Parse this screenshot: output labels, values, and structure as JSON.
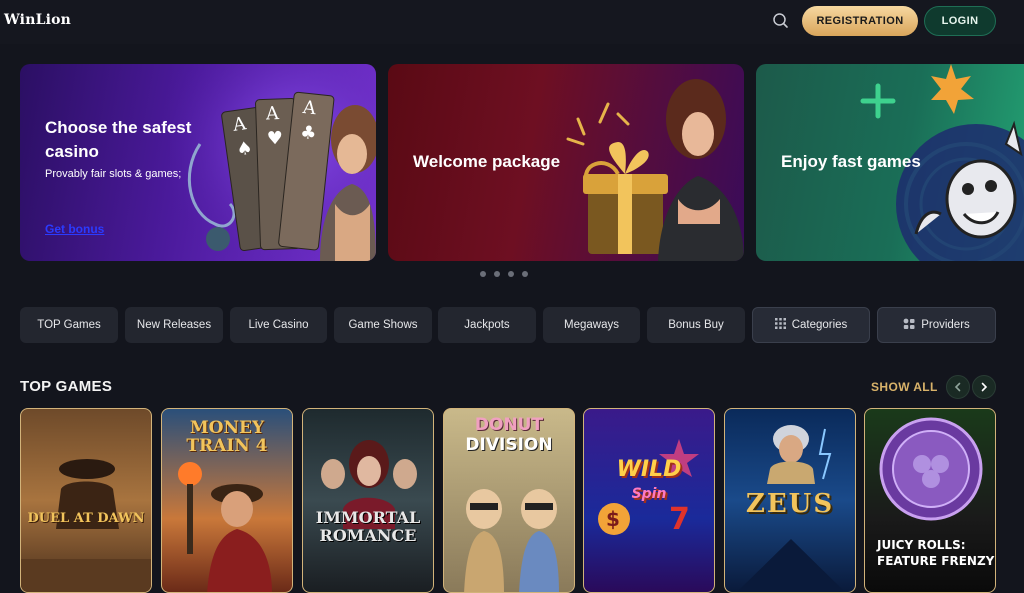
{
  "header": {
    "logo": "WinLion",
    "registration_label": "REGISTRATION",
    "login_label": "LOGIN",
    "search_icon": "search-icon"
  },
  "banners": [
    {
      "title_line1": "Choose the safest",
      "title_line2": "casino",
      "subtitle": "Provably fair slots & games;",
      "link": "Get bonus"
    },
    {
      "title": "Welcome package"
    },
    {
      "title": "Enjoy fast games"
    }
  ],
  "carousel": {
    "dot_count": 4
  },
  "categories": [
    {
      "label": "TOP Games"
    },
    {
      "label": "New Releases"
    },
    {
      "label": "Live Casino"
    },
    {
      "label": "Game Shows"
    },
    {
      "label": "Jackpots"
    },
    {
      "label": "Megaways"
    },
    {
      "label": "Bonus Buy"
    },
    {
      "label": "Categories",
      "icon": "grid-icon"
    },
    {
      "label": "Providers",
      "icon": "providers-icon"
    }
  ],
  "top_games": {
    "title": "TOP GAMES",
    "show_all": "SHOW ALL",
    "games": [
      {
        "title": "DUEL AT DAWN"
      },
      {
        "title_line1": "MONEY",
        "title_line2": "TRAIN 4"
      },
      {
        "title_line1": "IMMORTAL",
        "title_line2": "ROMANCE"
      },
      {
        "title_line1": "DONUT",
        "title_line2": "DIVISION"
      },
      {
        "title_line1": "WILD",
        "title_line2": "Spin"
      },
      {
        "title": "ZEUS"
      },
      {
        "title_line1": "JUICY ROLLS:",
        "title_line2": "FEATURE FRENZY"
      }
    ]
  },
  "colors": {
    "background": "#13151d",
    "accent_gold": "#d9b36a",
    "login_green": "#0f3a2e",
    "link_blue": "#2b3bff"
  }
}
